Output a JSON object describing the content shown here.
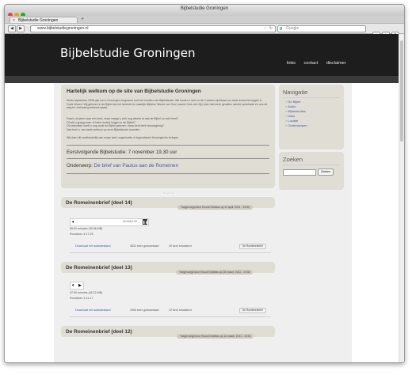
{
  "window": {
    "title": "Bijbelstudie Groningen",
    "tab_title": "Bijbelstudie Groningen",
    "url": "www.bijbelstudiegroningen.nl",
    "search_placeholder": "Google"
  },
  "site": {
    "title": "Bijbelstudie Groningen",
    "nav": [
      "links",
      "contact",
      "disclaimer"
    ]
  },
  "welcome": {
    "heading": "Hartelijk welkom op de site van Bijbelstudie Groningen",
    "paragraph1": "Sinds september 2008 zijn we in Groningen begonnen met het houden van Bijbelstudie. We komen 1 keer in de 2 weken bij elkaar om meer inzicht te krijgen in Gods Woord. Wij geloven in de Bijbel als het levende en waarlijk Bijbelse Woord van God, waarin God zich Zijn plan met deze gevallen wereld openbaart en ons de weg ter verlossing bekend maakt.",
    "paragraph2_lines": [
      "Gaat u al jaren naar een kerk, maar vraagt u zich nog steeds af wat de Bijbel nu echt leert?",
      "Of wilt u graag meer of beter inzicht krijgen in de Bijbel?",
      "Of misschien heeft u nog nooit de Bijbel gelezen, maar bent bent nieuwsgierig?",
      "Dan bent u van harte welkom op onze Bijbelstudie-avonden."
    ],
    "paragraph3": "Wij doen dit onafhankelijk van enige kerk, organisatie of dogmatische theologische leringen",
    "next_study_label": "Eerstvolgende Bijbelstudie: 7 november 19.30 uur",
    "subject_label": "Onderwerp:",
    "subject_link": "De brief van Paulus aan de Romeinen"
  },
  "sermons": [
    {
      "title": "De Romeinenbrief (deel 14)",
      "byline": "Toegevoegd door Ewout Keteltas op 11 april, 2011 - 19:30",
      "player_time": "00:00/81:30",
      "duration": "85:00 minutes (39.98 MB)",
      "passage": "Romeinen 4:17-25",
      "download": "Download het audiobestand",
      "downloads": "4531 keer gedownload",
      "listened": "30 keer beluisterd",
      "category": "De Romeinenbrief"
    },
    {
      "title": "De Romeinenbrief (deel 13)",
      "byline": "Toegevoegd door Ewout Keteltas op 28 maart, 2011 - 19:30",
      "player_time": "",
      "duration": "97:00 minutes (45.22 MB)",
      "passage": "Romeinen 4:14-17",
      "download": "Download het audiobestand",
      "downloads": "1950 keer gedownload",
      "listened": "12 keer beluisterd",
      "category": "De Romeinenbrief"
    },
    {
      "title": "De Romeinenbrief (deel 12)",
      "byline": "Toegevoegd door Ewout Keteltas op 14 maart, 2011 - 19:30"
    }
  ],
  "sidebar": {
    "nav_heading": "Navigatie",
    "nav_items": [
      "De Bijbel",
      "Audio",
      "Bijbelstudies",
      "Data",
      "Locatie",
      "Onderwerpen"
    ],
    "search_heading": "Zoeken",
    "search_button": "Zoeken"
  },
  "colors": {
    "header": "#1d1d1d",
    "box": "#e0ddd5",
    "link": "#3a5aa8",
    "page": "#efefef"
  }
}
